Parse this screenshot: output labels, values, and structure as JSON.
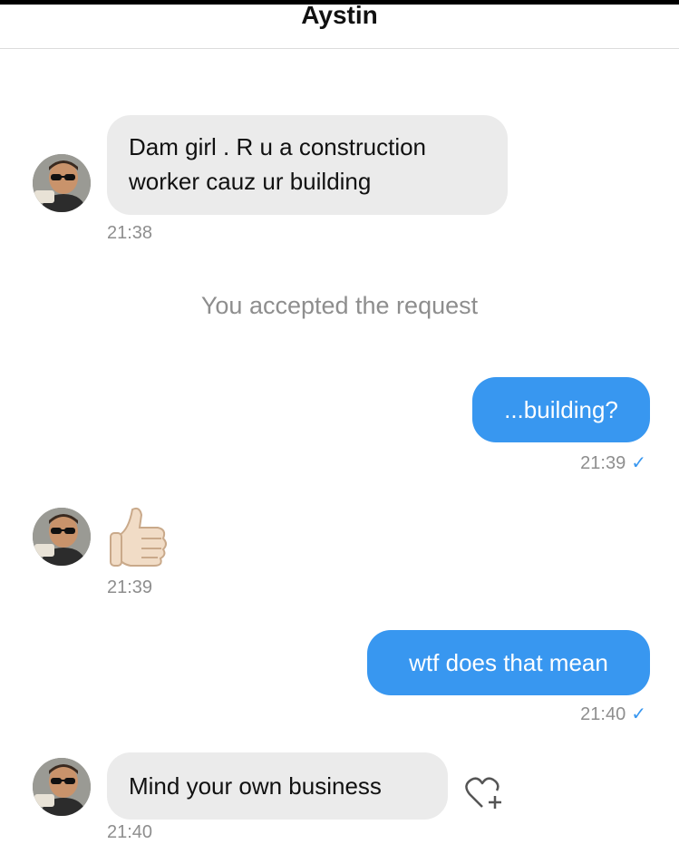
{
  "header": {
    "title": "Aystin"
  },
  "messages": [
    {
      "type": "incoming",
      "line1": "Dam girl . R u a construction",
      "line2": "worker cauz ur building",
      "time": "21:38"
    },
    {
      "type": "system",
      "text": "You accepted the request"
    },
    {
      "type": "outgoing",
      "text": "...building?",
      "time": "21:39",
      "status_icon": "check-icon"
    },
    {
      "type": "incoming-emoji",
      "emoji": "thumbs-up-icon",
      "time": "21:39"
    },
    {
      "type": "outgoing",
      "text": "wtf does that mean",
      "time": "21:40",
      "status_icon": "check-icon"
    },
    {
      "type": "incoming",
      "text": "Mind your own business",
      "time": "21:40",
      "reaction_icon": "heart-add-icon"
    }
  ],
  "colors": {
    "outgoing_bubble": "#3897f0",
    "incoming_bubble": "#ebebeb",
    "meta_text": "#8e8e8e"
  }
}
